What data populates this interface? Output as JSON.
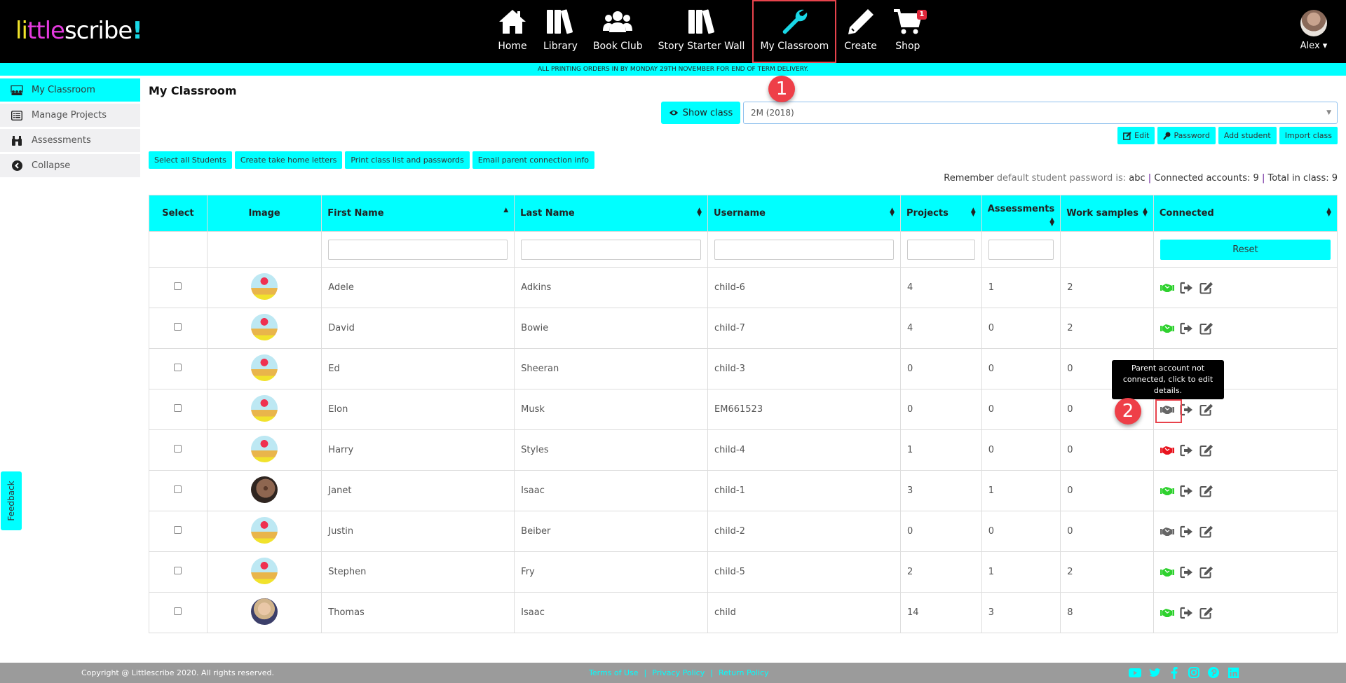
{
  "brand": {
    "logo_parts": [
      "li",
      "ttle",
      "scribe",
      "!"
    ]
  },
  "nav": {
    "items": [
      {
        "label": "Home",
        "icon": "home-icon"
      },
      {
        "label": "Library",
        "icon": "books-icon"
      },
      {
        "label": "Book Club",
        "icon": "users-icon"
      },
      {
        "label": "Story Starter Wall",
        "icon": "books-icon"
      },
      {
        "label": "My Classroom",
        "icon": "wrench-icon",
        "active": true
      },
      {
        "label": "Create",
        "icon": "pencil-icon"
      },
      {
        "label": "Shop",
        "icon": "cart-icon",
        "badge": "1"
      }
    ],
    "user": {
      "name": "Alex",
      "caret": "▾"
    }
  },
  "banner": {
    "text": "ALL PRINTING ORDERS IN BY MONDAY 29TH NOVEMBER FOR END OF TERM DELIVERY."
  },
  "sidebar": {
    "items": [
      {
        "label": "My Classroom",
        "icon": "classroom-icon",
        "active": true
      },
      {
        "label": "Manage Projects",
        "icon": "list-icon"
      },
      {
        "label": "Assessments",
        "icon": "binoculars-icon"
      },
      {
        "label": "Collapse",
        "icon": "chevron-left-circle-icon"
      }
    ]
  },
  "main": {
    "title": "My Classroom",
    "show_class_label": "Show class",
    "class_select_value": "2M (2018)",
    "toolbar_right": [
      "Edit",
      "Password",
      "Add student",
      "Import class"
    ],
    "toolbar_left": [
      "Select all Students",
      "Create take home letters",
      "Print class list and passwords",
      "Email parent connection info"
    ],
    "info": {
      "remember": "Remember",
      "default_text": "default student password is:",
      "password": "abc",
      "sep": "|",
      "connected": "Connected accounts: 9",
      "total": "Total in class: 9"
    }
  },
  "table": {
    "headers": [
      "Select",
      "Image",
      "First Name",
      "Last Name",
      "Username",
      "Projects",
      "Assessments",
      "Work samples",
      "Connected"
    ],
    "reset_label": "Reset",
    "rows": [
      {
        "first": "Adele",
        "last": "Adkins",
        "username": "child-6",
        "projects": "4",
        "assessments": "1",
        "work": "2",
        "status": "connected",
        "avatar": "drawing"
      },
      {
        "first": "David",
        "last": "Bowie",
        "username": "child-7",
        "projects": "4",
        "assessments": "0",
        "work": "2",
        "status": "connected",
        "avatar": "drawing"
      },
      {
        "first": "Ed",
        "last": "Sheeran",
        "username": "child-3",
        "projects": "0",
        "assessments": "0",
        "work": "0",
        "status": "hidden",
        "avatar": "drawing"
      },
      {
        "first": "Elon",
        "last": "Musk",
        "username": "EM661523",
        "projects": "0",
        "assessments": "0",
        "work": "0",
        "status": "not-connected",
        "avatar": "drawing"
      },
      {
        "first": "Harry",
        "last": "Styles",
        "username": "child-4",
        "projects": "1",
        "assessments": "0",
        "work": "0",
        "status": "error",
        "avatar": "drawing"
      },
      {
        "first": "Janet",
        "last": "Isaac",
        "username": "child-1",
        "projects": "3",
        "assessments": "1",
        "work": "0",
        "status": "connected",
        "avatar": "face1"
      },
      {
        "first": "Justin",
        "last": "Beiber",
        "username": "child-2",
        "projects": "0",
        "assessments": "0",
        "work": "0",
        "status": "not-connected",
        "avatar": "drawing"
      },
      {
        "first": "Stephen",
        "last": "Fry",
        "username": "child-5",
        "projects": "2",
        "assessments": "1",
        "work": "2",
        "status": "connected",
        "avatar": "drawing"
      },
      {
        "first": "Thomas",
        "last": "Isaac",
        "username": "child",
        "projects": "14",
        "assessments": "3",
        "work": "8",
        "status": "connected",
        "avatar": "face2"
      }
    ],
    "status_colors": {
      "connected": "#2ed12e",
      "not-connected": "#666666",
      "error": "#e8141e",
      "hidden": "#666666"
    }
  },
  "tooltip": {
    "text": "Parent account not connected, click to edit details."
  },
  "annotations": {
    "marker1": "1",
    "marker2": "2"
  },
  "feedback_label": "Feedback",
  "footer": {
    "copyright": "Copyright @ Littlescribe 2020. All rights reserved.",
    "links": [
      "Terms of Use",
      "|",
      "Privacy Policy",
      "|",
      "Return Policy"
    ],
    "social": [
      "youtube-icon",
      "twitter-icon",
      "facebook-icon",
      "instagram-icon",
      "pinterest-icon",
      "linkedin-icon"
    ]
  },
  "colors": {
    "accent": "#00ffff",
    "nav_bg": "#000000",
    "annotation": "#ee3f48",
    "footer_bg": "#9b9b9b"
  }
}
